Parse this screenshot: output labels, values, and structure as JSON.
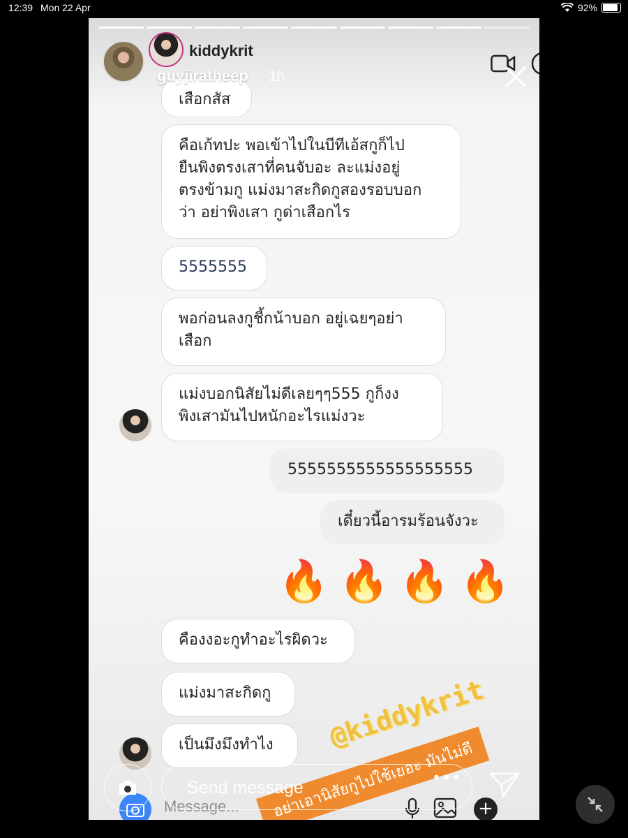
{
  "status_bar": {
    "time": "12:39",
    "date": "Mon 22 Apr",
    "battery": "92%"
  },
  "story": {
    "username": "guyjiratheep",
    "time_ago": "1h",
    "progress_segments": 9
  },
  "chat": {
    "contact_name": "kiddykrit",
    "messages": [
      {
        "side": "received",
        "text": "เสือกสัส"
      },
      {
        "side": "received",
        "text": "คือเก้ทปะ พอเข้าไปในบีทีเอ้สกูก็ไป\nยืนพิงตรงเสาที่คนจับอะ ละแม่งอยู่\nตรงข้ามกู แม่งมาสะกิดกูสองรอบบอก\nว่า อย่าพิงเสา กูด่าเสือกไร"
      },
      {
        "side": "received",
        "text": "5555555"
      },
      {
        "side": "received",
        "text": "พอก่อนลงกูชี้กน้าบอก อยู่เฉยๆอย่า\nเสือก"
      },
      {
        "side": "received",
        "text": "แม่งบอกนิสัยไม่ดีเลยๆๆ555 กูก็งง\nพิงเสามันไปหนักอะไรแม่งวะ"
      },
      {
        "side": "sent",
        "text": "5555555555555555555"
      },
      {
        "side": "sent",
        "text": "เดี๋ยวนี้อารมร้อนจังวะ"
      },
      {
        "side": "sent",
        "text": "🔥 🔥 🔥 🔥"
      },
      {
        "side": "received",
        "text": "คืองงอะกูทำอะไรผิดวะ"
      },
      {
        "side": "received",
        "text": "แม่งมาสะกิดกู"
      },
      {
        "side": "received",
        "text": "เป็นมึงมึงทำไง"
      }
    ],
    "composer_placeholder": "Message..."
  },
  "stickers": {
    "handle": "@kiddykrit",
    "banner": "อย่าเอานิสัยกูไปใช้เยอะ มันไม่ดี"
  },
  "reply": {
    "placeholder": "Send message",
    "dots": "•••"
  },
  "colors": {
    "story_bg": "#f4f4f4",
    "sticker_orange": "#ef8a2e",
    "sticker_yellow": "#f0c040",
    "ig_blue": "#3b86f7"
  }
}
